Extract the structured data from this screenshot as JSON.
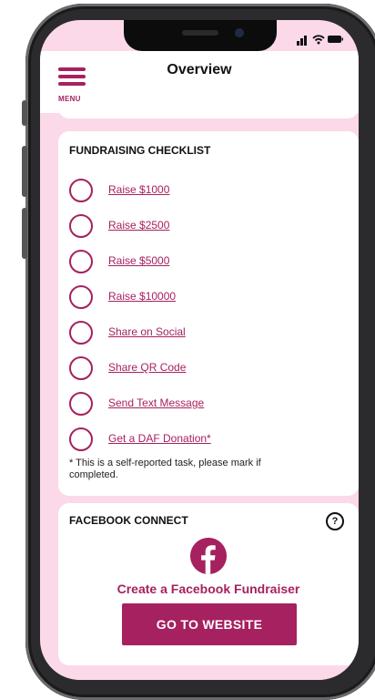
{
  "header": {
    "menu_label": "MENU",
    "title": "Overview"
  },
  "checklist": {
    "title": "FUNDRAISING CHECKLIST",
    "items": [
      {
        "label": "Raise $1000"
      },
      {
        "label": "Raise $2500"
      },
      {
        "label": "Raise $5000"
      },
      {
        "label": "Raise $10000"
      },
      {
        "label": "Share on Social"
      },
      {
        "label": "Share QR Code"
      },
      {
        "label": "Send Text Message"
      },
      {
        "label": "Get a DAF Donation*"
      }
    ],
    "note": "* This is a self-reported task, please mark if completed."
  },
  "facebook": {
    "title": "FACEBOOK CONNECT",
    "help_glyph": "?",
    "icon": "facebook-icon",
    "caption": "Create a Facebook Fundraiser",
    "button_label": "GO TO WEBSITE"
  },
  "colors": {
    "accent": "#a6215f",
    "background": "#fbd9e9",
    "card": "#ffffff"
  }
}
